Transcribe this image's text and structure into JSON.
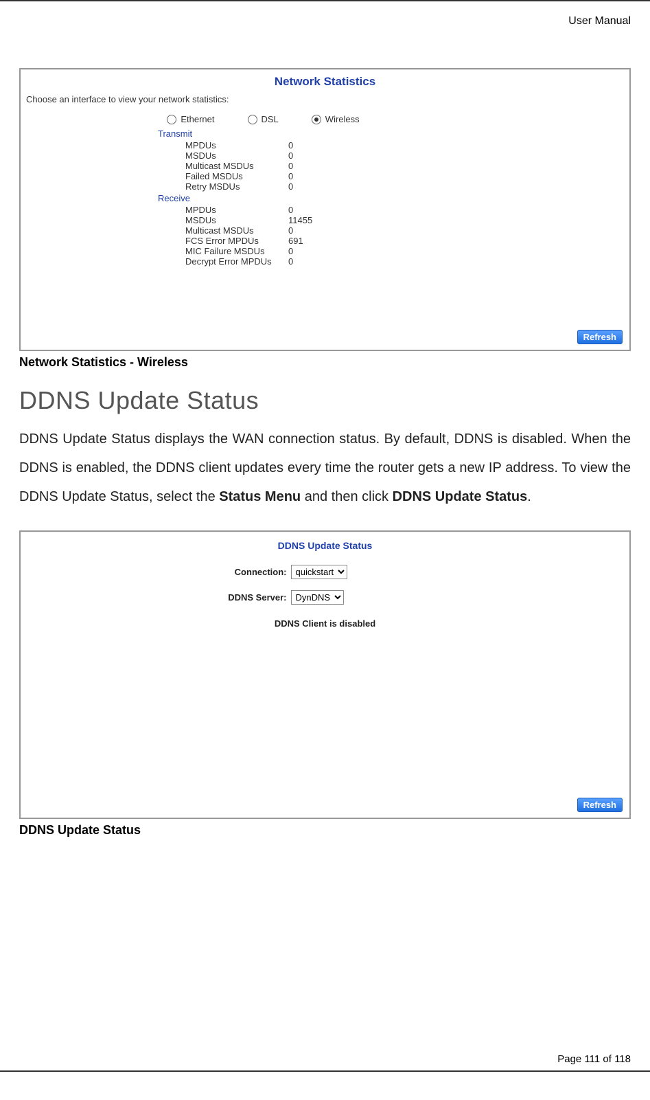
{
  "doc": {
    "header": "User Manual",
    "footer": "Page 111 of 118"
  },
  "network_stats": {
    "title": "Network Statistics",
    "choose_text": "Choose an interface to view your network statistics:",
    "radios": {
      "ethernet": "Ethernet",
      "dsl": "DSL",
      "wireless": "Wireless",
      "selected": "wireless"
    },
    "transmit": {
      "label": "Transmit",
      "rows": [
        {
          "k": "MPDUs",
          "v": "0"
        },
        {
          "k": "MSDUs",
          "v": "0"
        },
        {
          "k": "Multicast MSDUs",
          "v": "0"
        },
        {
          "k": "Failed MSDUs",
          "v": "0"
        },
        {
          "k": "Retry MSDUs",
          "v": "0"
        }
      ]
    },
    "receive": {
      "label": "Receive",
      "rows": [
        {
          "k": "MPDUs",
          "v": "0"
        },
        {
          "k": "MSDUs",
          "v": "11455"
        },
        {
          "k": "Multicast MSDUs",
          "v": "0"
        },
        {
          "k": "FCS Error MPDUs",
          "v": "691"
        },
        {
          "k": "MIC Failure MSDUs",
          "v": "0"
        },
        {
          "k": "Decrypt Error MPDUs",
          "v": "0"
        }
      ]
    },
    "refresh": "Refresh",
    "caption": "Network Statistics - Wireless"
  },
  "section": {
    "heading": "DDNS Update Status",
    "paragraph_pre": "DDNS Update Status displays the WAN connection status. By default, DDNS is disabled. When the DDNS is enabled, the DDNS client updates every time the router gets a new IP address. To view the DDNS Update Status, select the ",
    "bold1": "Status Menu",
    "mid": " and then click ",
    "bold2": "DDNS Update Status",
    "end": "."
  },
  "ddns": {
    "title": "DDNS Update Status",
    "connection": {
      "label": "Connection:",
      "value": "quickstart"
    },
    "server": {
      "label": "DDNS Server:",
      "value": "DynDNS"
    },
    "status_text": "DDNS Client is disabled",
    "refresh": "Refresh",
    "caption": "DDNS Update Status"
  }
}
